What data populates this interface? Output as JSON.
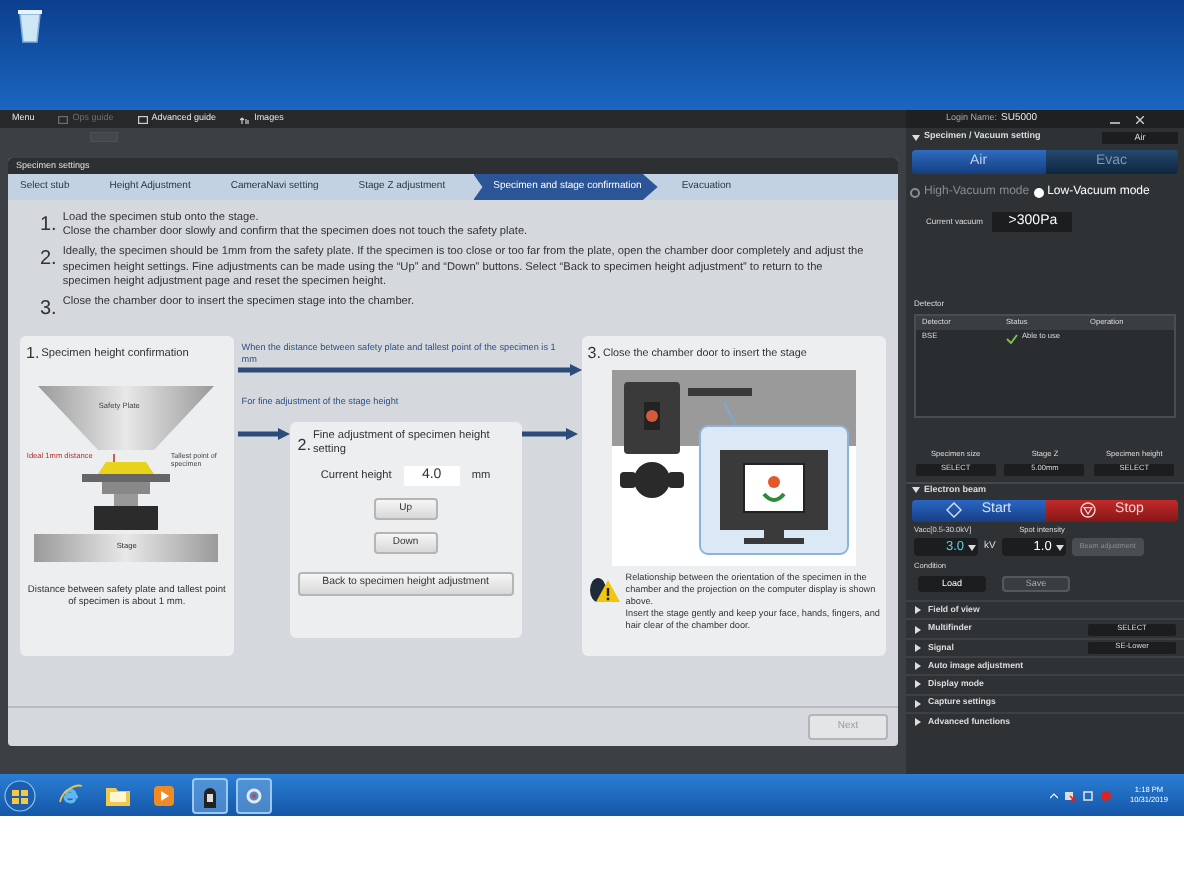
{
  "menu_bar": {
    "items": [
      {
        "label": "Menu",
        "disabled": false,
        "kind": "text"
      },
      {
        "label": "Ops guide",
        "disabled": true,
        "kind": "guide"
      },
      {
        "label": "Advanced guide",
        "disabled": false,
        "kind": "guide"
      },
      {
        "label": "Images",
        "disabled": false,
        "kind": "images"
      }
    ]
  },
  "dialog": {
    "title": "Specimen settings",
    "steps": [
      {
        "label": "Select stub",
        "selected": false
      },
      {
        "label": "Height Adjustment",
        "selected": false
      },
      {
        "label": "CameraNavi setting",
        "selected": false
      },
      {
        "label": "Stage Z adjustment",
        "selected": false
      },
      {
        "label": "Specimen and stage confirmation",
        "selected": true
      },
      {
        "label": "Evacuation",
        "selected": false
      }
    ],
    "instructions": [
      {
        "number": "1.",
        "lines": [
          "Load the specimen stub onto the  stage.",
          "Close the chamber door slowly and confirm that the specimen does not touch the  safety plate."
        ]
      },
      {
        "number": "2.",
        "lines": [
          "Ideally, the specimen should be 1mm from the safety plate. If the specimen is too close or too far from the plate, open the chamber door completely and adjust the specimen height settings. Fine adjustments can be made using the “Up” and “Down” buttons. Select “Back to specimen height adjustment” to return to the specimen height adjustment page and reset the specimen height."
        ]
      },
      {
        "number": "3.",
        "lines": [
          "Close the chamber door to insert the specimen stage into the chamber."
        ]
      }
    ],
    "card1": {
      "number": "1.",
      "title": "Specimen height confirmation",
      "safety_plate": "Safety Plate",
      "ideal": "Ideal 1mm distance",
      "tallest": "Tallest point of specimen",
      "stage": "Stage",
      "caption": "Distance between safety plate and tallest point of specimen is about 1 mm."
    },
    "flow_labels": [
      "When the  distance between safety plate and tallest point of the specimen is 1 mm",
      "For fine adjustment of the stage height"
    ],
    "card2": {
      "number": "2.",
      "title": "Fine adjustment of specimen height setting",
      "height_label": "Current height",
      "height_value": "4.0",
      "unit": "mm",
      "buttons": [
        "Up",
        "Down"
      ],
      "back_button": "Back to specimen height adjustment"
    },
    "card3": {
      "number": "3.",
      "title": "Close the chamber door to insert the stage",
      "notes": [
        "Relationship between  the orientation of the specimen in the chamber and the projection on the computer display is shown above.",
        "Insert the stage gently  and keep your face, hands, fingers, and hair clear of the chamber door."
      ]
    },
    "next_button": {
      "label": "Next",
      "disabled": true
    }
  },
  "side_panel": {
    "login_label": "Login Name:",
    "login_name": "SU5000",
    "vacuum": {
      "title": "Specimen / Vacuum setting",
      "status": "Air",
      "toggle": [
        {
          "label": "Air",
          "selected": true
        },
        {
          "label": "Evac",
          "selected": false
        }
      ],
      "modes": [
        {
          "label": "High-Vacuum mode",
          "selected": false
        },
        {
          "label": "Low-Vacuum mode",
          "selected": true
        }
      ],
      "vacuum_label": "Current vacuum",
      "vacuum_value": ">300Pa",
      "detector_title": "Detector",
      "detector_columns": [
        "Detector",
        "Status",
        "Operation"
      ],
      "detector_rows": [
        {
          "detector": "BSE",
          "status": "Able to use"
        }
      ],
      "stage": [
        {
          "label": "Specimen size",
          "value": "SELECT"
        },
        {
          "label": "Stage Z",
          "value": "5.00mm"
        },
        {
          "label": "Specimen height",
          "value": "SELECT"
        }
      ]
    },
    "beam": {
      "title": "Electron beam",
      "start": "Start",
      "stop": "Stop",
      "vacc_label": "Vacc[0.5-30.0kV]",
      "vacc_value": "3.0",
      "vacc_unit": "kV",
      "spot_label": "Spot intensity",
      "spot_value": "1.0",
      "beam_adjust": {
        "label": "Beam adjustment",
        "disabled": true
      },
      "condition_label": "Condition",
      "load": {
        "label": "Load",
        "disabled": false
      },
      "save": {
        "label": "Save",
        "disabled": true
      }
    },
    "sections": [
      {
        "label": "Field of view"
      },
      {
        "label": "Multifinder",
        "value": "SELECT"
      },
      {
        "label": "Signal",
        "value": "SE-Lower"
      },
      {
        "label": "Auto image adjustment"
      },
      {
        "label": "Display mode"
      },
      {
        "label": "Capture settings"
      },
      {
        "label": "Advanced functions"
      }
    ]
  },
  "taskbar": {
    "time": "1:18 PM",
    "date": "10/31/2019"
  }
}
